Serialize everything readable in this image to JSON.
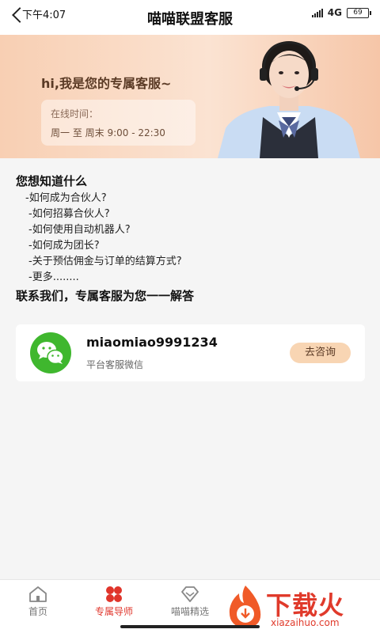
{
  "status_bar": {
    "time": "下午4:07",
    "network": "4G",
    "battery": "69"
  },
  "header": {
    "title": "喵喵联盟客服"
  },
  "banner": {
    "greeting": "hi,我是您的专属客服~",
    "hours_label": "在线时间：",
    "hours_value": "周一 至 周末 9:00 - 22:30"
  },
  "faq": {
    "title": "您想知道什么",
    "items": [
      "-如何成为合伙人?",
      "-如何招募合伙人?",
      "-如何使用自动机器人?",
      "-如何成为团长?",
      "-关于预估佣金与订单的结算方式?",
      "-更多........"
    ],
    "contact_line": "联系我们，专属客服为您一一解答"
  },
  "contact_card": {
    "account_id": "miaomiao9991234",
    "description": "平台客服微信",
    "button_label": "去咨询",
    "icon": "wechat-icon"
  },
  "bottom_nav": {
    "items": [
      {
        "label": "首页",
        "icon": "home-icon",
        "active": false
      },
      {
        "label": "专属导师",
        "icon": "clover-icon",
        "active": true
      },
      {
        "label": "喵喵精选",
        "icon": "diamond-icon",
        "active": false
      }
    ]
  },
  "watermark": {
    "text": "下载火",
    "sub": "xiazaihuo.com"
  },
  "colors": {
    "accent": "#e0352b",
    "banner": "#f8cfb3",
    "wechat": "#3fb72e",
    "button": "#f8d5b3"
  }
}
